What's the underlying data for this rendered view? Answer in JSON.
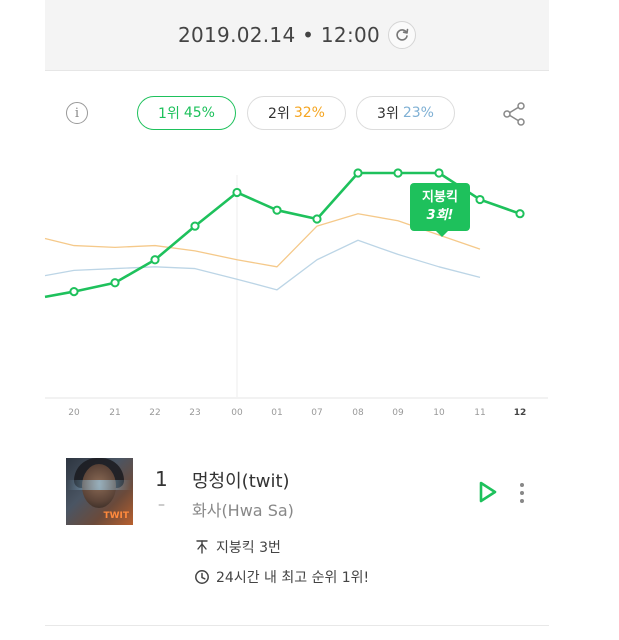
{
  "header": {
    "datetime": "2019.02.14 • 12:00",
    "refresh_icon": "refresh-icon"
  },
  "pills": [
    {
      "rank": "1위",
      "pct": "45%",
      "color": "#1ec15c"
    },
    {
      "rank": "2위",
      "pct": "32%",
      "color": "#f5a623"
    },
    {
      "rank": "3위",
      "pct": "23%",
      "color": "#7fb0d4"
    }
  ],
  "icons": {
    "info": "info-icon",
    "share": "share-icon",
    "play": "play-icon",
    "more": "more-vertical-icon",
    "peak": "peak-icon",
    "clock": "clock-icon"
  },
  "tooltip": {
    "line1": "지붕킥",
    "line2": "3회!"
  },
  "chart_data": {
    "type": "line",
    "categories": [
      "20",
      "21",
      "22",
      "23",
      "00",
      "01",
      "07",
      "08",
      "09",
      "10",
      "11",
      "12"
    ],
    "ylim": [
      0,
      100
    ],
    "series": [
      {
        "color": "#1ec15c",
        "lead": 30,
        "values": [
          33,
          38,
          51,
          70,
          89,
          79,
          74,
          100,
          100,
          100,
          85,
          77
        ]
      },
      {
        "color": "#f5c98a",
        "lead": 63,
        "values": [
          59,
          58,
          59,
          56,
          51,
          47,
          70,
          77,
          73,
          65,
          57
        ]
      },
      {
        "color": "#bcd5e6",
        "lead": 42,
        "values": [
          45,
          46,
          47,
          46,
          40,
          34,
          51,
          62,
          54,
          47,
          41
        ]
      }
    ],
    "grid_lines_at": [
      "00"
    ]
  },
  "song": {
    "rank": "1",
    "rank_change": "–",
    "title": "멍청이(twit)",
    "artist": "화사(Hwa Sa)",
    "album_text": "TWIT",
    "peak_text": "지붕킥 3번",
    "best_text": "24시간 내 최고 순위 1위!"
  }
}
